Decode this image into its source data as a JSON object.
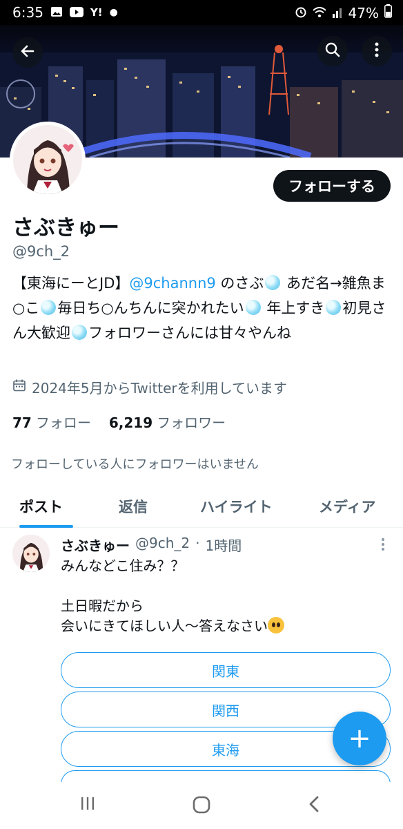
{
  "status_bar": {
    "time": "6:35",
    "battery": "47%",
    "icons": [
      "gallery-icon",
      "youtube-icon",
      "yahoo-icon",
      "dot-icon",
      "alarm-icon",
      "wifi-icon",
      "signal-icon",
      "battery-icon"
    ]
  },
  "header": {
    "back_icon": "arrow-left-icon",
    "search_icon": "search-icon",
    "more_icon": "more-vertical-icon"
  },
  "profile": {
    "follow_label": "フォローする",
    "name": "さぶきゅー",
    "handle": "@9ch_2",
    "bio_prefix": "【東海にーとJD】",
    "bio_link": "@9channn9",
    "bio_part1": " のさぶ",
    "bio_part2": " あだ名→雑魚ま○こ",
    "bio_part3": "毎日ち○んちんに突かれたい",
    "bio_part4": " 年上すき",
    "bio_part5": "初見さん大歓迎",
    "bio_part6": "フォロワーさんには甘々やんね",
    "joined": "2024年5月からTwitterを利用しています",
    "following_count": "77",
    "following_label": "フォロー",
    "followers_count": "6,219",
    "followers_label": "フォロワー",
    "known_followers": "フォローしている人にフォロワーはいません"
  },
  "tabs": [
    {
      "label": "ポスト",
      "active": true
    },
    {
      "label": "返信",
      "active": false
    },
    {
      "label": "ハイライト",
      "active": false
    },
    {
      "label": "メディア",
      "active": false
    }
  ],
  "post": {
    "author": "さぶきゅー",
    "handle": "@9ch_2",
    "separator": "·",
    "time": "1時間",
    "line1": "みんなどこ住み？？",
    "line2": "土日暇だから",
    "line3": "会いにきてほしい人〜答えなさい",
    "poll_options": [
      "関東",
      "関西",
      "東海"
    ]
  },
  "fab_label": "+",
  "nav": {
    "icons": [
      "recent-apps-icon",
      "home-icon",
      "back-icon"
    ]
  }
}
